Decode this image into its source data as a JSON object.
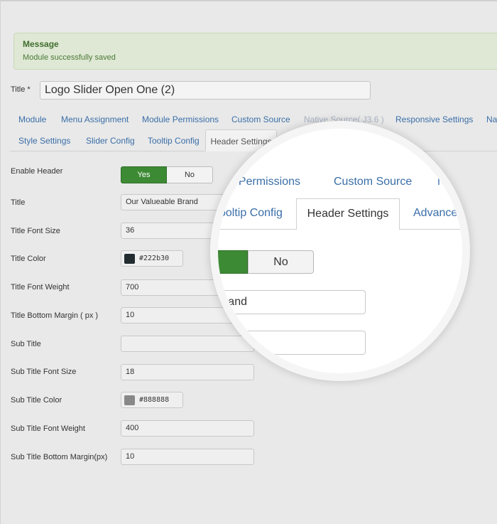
{
  "message": {
    "title": "Message",
    "text": "Module successfully saved"
  },
  "title_field": {
    "label": "Title *",
    "value": "Logo Slider Open One (2)"
  },
  "tabs_row1": [
    {
      "label": "Module"
    },
    {
      "label": "Menu Assignment"
    },
    {
      "label": "Module Permissions"
    },
    {
      "label": "Custom Source"
    },
    {
      "label": "Native Source( J3.6 )"
    },
    {
      "label": "Responsive Settings"
    },
    {
      "label": "Na"
    }
  ],
  "tabs_row2": [
    {
      "label": "Style Settings"
    },
    {
      "label": "Slider Config"
    },
    {
      "label": "Tooltip Config"
    },
    {
      "label": "Header Settings",
      "active": true
    }
  ],
  "form": {
    "enable_header": {
      "label": "Enable Header",
      "yes": "Yes",
      "no": "No",
      "selected": "Yes"
    },
    "title": {
      "label": "Title",
      "value": "Our Valueable Brand"
    },
    "title_font_size": {
      "label": "Title Font Size",
      "value": "36"
    },
    "title_color": {
      "label": "Title Color",
      "value": "#222b30",
      "swatch": "#222b30"
    },
    "title_font_weight": {
      "label": "Title Font Weight",
      "value": "700"
    },
    "title_bottom_margin": {
      "label": "Title Bottom Margin ( px )",
      "value": "10"
    },
    "sub_title": {
      "label": "Sub Title",
      "value": ""
    },
    "sub_title_font_size": {
      "label": "Sub Title Font Size",
      "value": "18"
    },
    "sub_title_color": {
      "label": "Sub Title Color",
      "value": "#888888",
      "swatch": "#888888"
    },
    "sub_title_font_weight": {
      "label": "Sub Title Font Weight",
      "value": "400"
    },
    "sub_title_bottom_margin": {
      "label": "Sub Title Bottom Margin(px)",
      "value": "10"
    }
  },
  "magnifier": {
    "tab_permissions": "le Permissions",
    "tab_custom_source": "Custom Source",
    "tab_na": "Na",
    "tab_tooltip": "ooltip Config",
    "tab_header": "Header Settings",
    "tab_advanced": "Advanced",
    "no_label": "No",
    "title_value": "able Brand"
  }
}
